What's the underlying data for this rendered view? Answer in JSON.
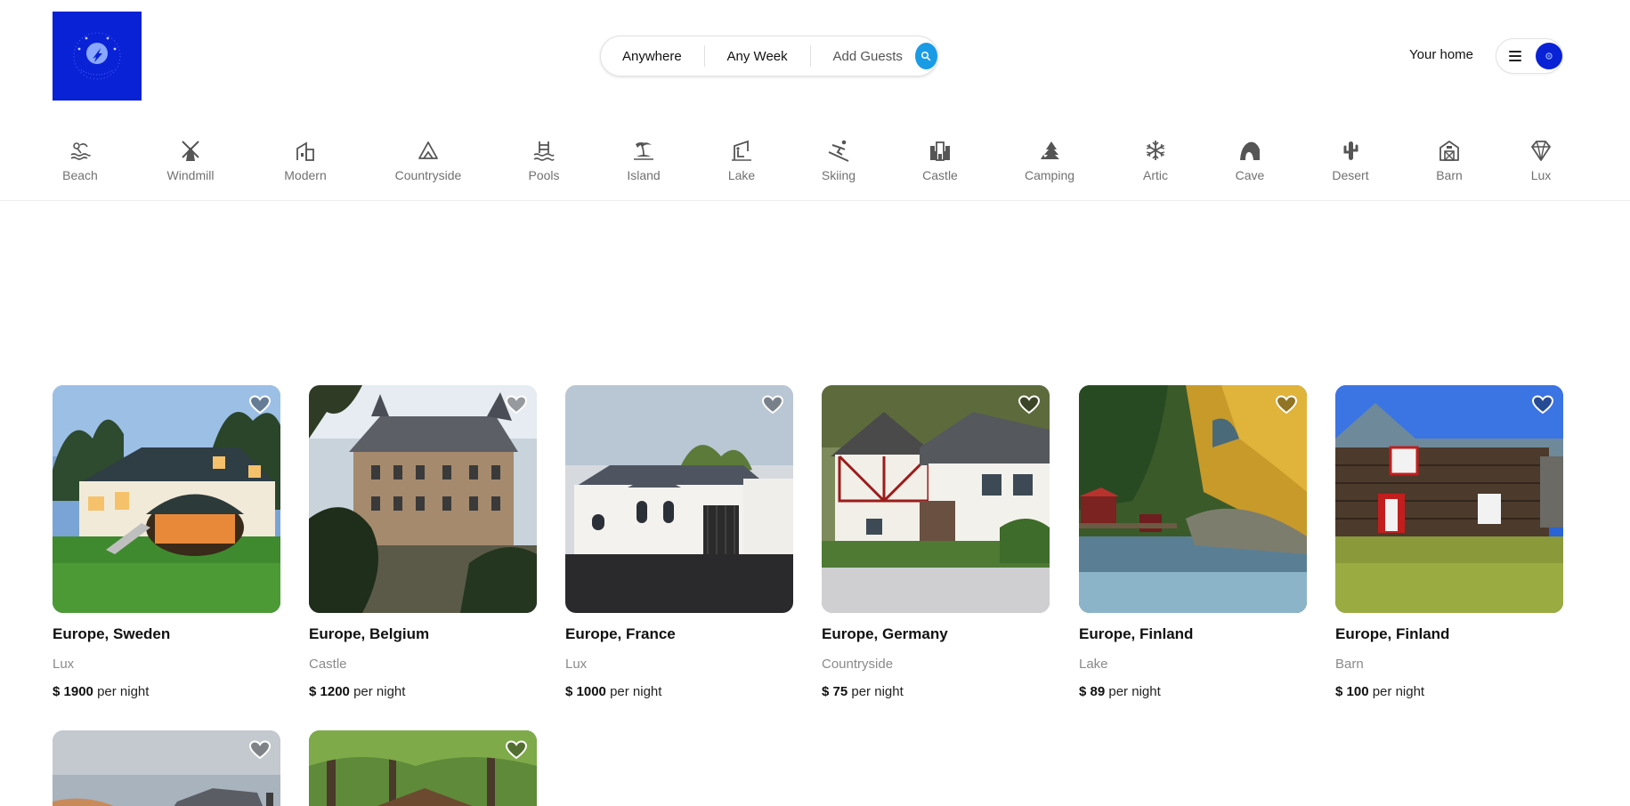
{
  "header": {
    "logo_icon": "brand-logo",
    "search": {
      "where": "Anywhere",
      "when": "Any Week",
      "guests": "Add Guests",
      "button_icon": "search-icon"
    },
    "your_home": "Your home",
    "menu_icon": "hamburger-icon",
    "avatar_icon": "avatar-icon"
  },
  "categories": [
    {
      "label": "Beach",
      "icon": "beach-icon"
    },
    {
      "label": "Windmill",
      "icon": "windmill-icon"
    },
    {
      "label": "Modern",
      "icon": "modern-icon"
    },
    {
      "label": "Countryside",
      "icon": "mountain-icon"
    },
    {
      "label": "Pools",
      "icon": "pool-icon"
    },
    {
      "label": "Island",
      "icon": "island-icon"
    },
    {
      "label": "Lake",
      "icon": "lake-icon"
    },
    {
      "label": "Skiing",
      "icon": "skiing-icon"
    },
    {
      "label": "Castle",
      "icon": "castle-icon"
    },
    {
      "label": "Camping",
      "icon": "camping-icon"
    },
    {
      "label": "Artic",
      "icon": "snowflake-icon"
    },
    {
      "label": "Cave",
      "icon": "cave-icon"
    },
    {
      "label": "Desert",
      "icon": "cactus-icon"
    },
    {
      "label": "Barn",
      "icon": "barn-icon"
    },
    {
      "label": "Lux",
      "icon": "diamond-icon"
    }
  ],
  "listings": [
    {
      "location": "Europe, Sweden",
      "category": "Lux",
      "price": "$ 1900",
      "unit": "per night"
    },
    {
      "location": "Europe, Belgium",
      "category": "Castle",
      "price": "$ 1200",
      "unit": "per night"
    },
    {
      "location": "Europe, France",
      "category": "Lux",
      "price": "$ 1000",
      "unit": "per night"
    },
    {
      "location": "Europe, Germany",
      "category": "Countryside",
      "price": "$ 75",
      "unit": "per night"
    },
    {
      "location": "Europe, Finland",
      "category": "Lake",
      "price": "$ 89",
      "unit": "per night"
    },
    {
      "location": "Europe, Finland",
      "category": "Barn",
      "price": "$ 100",
      "unit": "per night"
    }
  ],
  "colors": {
    "brand": "#0a22d6",
    "search_button": "#1a9be6",
    "muted_text": "#717171"
  }
}
